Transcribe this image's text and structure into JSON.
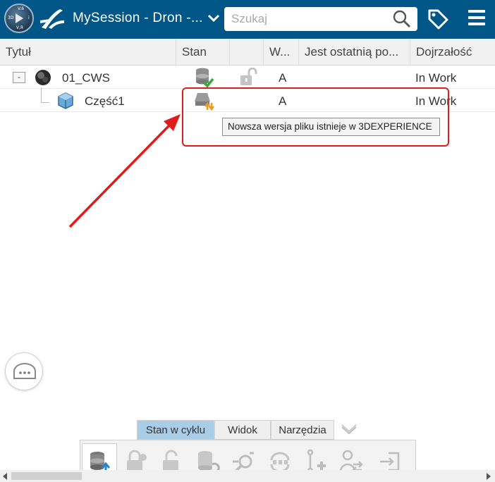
{
  "header": {
    "title": "MySession - Dron -...",
    "search_placeholder": "Szukaj",
    "compass": {
      "north": "V.6",
      "west": "3D",
      "east": "i",
      "south": "V,R"
    }
  },
  "columns": [
    "Tytuł",
    "Stan",
    "",
    "W...",
    "Jest ostatnią po...",
    "Dojrzałość"
  ],
  "rows": [
    {
      "title": "01_CWS",
      "collapse": "-",
      "state_icon": "database-check-icon",
      "lock_icon": "unlocked-icon",
      "revision": "A",
      "maturity": "In Work"
    },
    {
      "title": "Część1",
      "state_icon": "newer-version-icon",
      "revision": "A",
      "maturity": "In Work"
    }
  ],
  "tooltip": "Nowsza wersja pliku istnieje w 3DEXPERIENCE",
  "bottom_tabs": [
    {
      "label": "Stan w cyklu",
      "active": true
    },
    {
      "label": "Widok",
      "active": false
    },
    {
      "label": "Narzędzia",
      "active": false
    }
  ],
  "toolbar_icons": [
    "refresh-from-server-icon",
    "lock-icon",
    "unlock-icon",
    "reload-icon",
    "explore-icon",
    "sync-icon",
    "add-relation-icon",
    "transfer-ownership-icon",
    "exit-icon"
  ],
  "colors": {
    "header": "#005686",
    "highlight": "#e01b1b",
    "active_tab": "#a9cde6"
  }
}
